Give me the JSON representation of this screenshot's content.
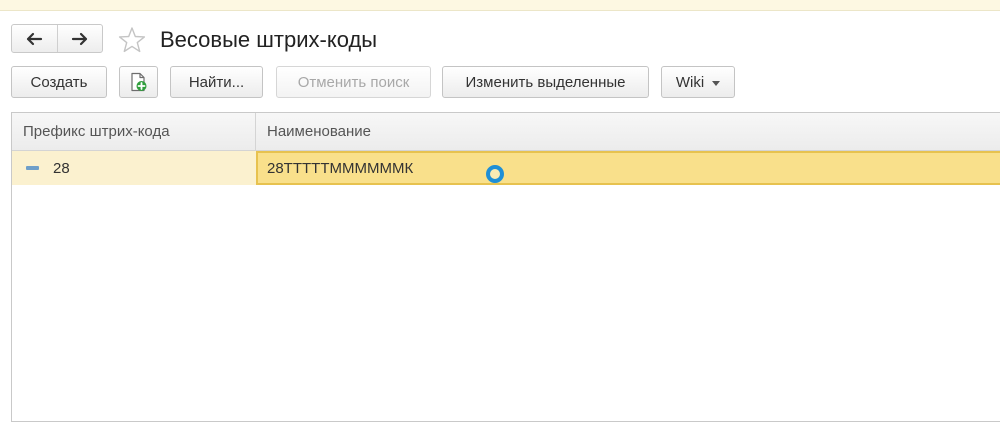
{
  "header": {
    "title": "Весовые штрих-коды",
    "back_icon": "arrow-left-icon",
    "forward_icon": "arrow-right-icon",
    "favorite_icon": "star-icon"
  },
  "toolbar": {
    "create_label": "Создать",
    "copy_icon": "add-document-icon",
    "find_label": "Найти...",
    "cancel_search_label": "Отменить поиск",
    "edit_selected_label": "Изменить выделенные",
    "wiki_label": "Wiki"
  },
  "table": {
    "columns": [
      "Префикс штрих-кода",
      "Наименование"
    ],
    "rows": [
      {
        "prefix": "28",
        "name": "28ТТТТТММММММК",
        "selected": true
      }
    ]
  },
  "colors": {
    "selected_row": "#fbf1cf",
    "active_cell": "#f9e08b",
    "active_cell_border": "#e7c24f",
    "row_marker": "#6f9fc9",
    "cursor": "#1f8fd6"
  }
}
